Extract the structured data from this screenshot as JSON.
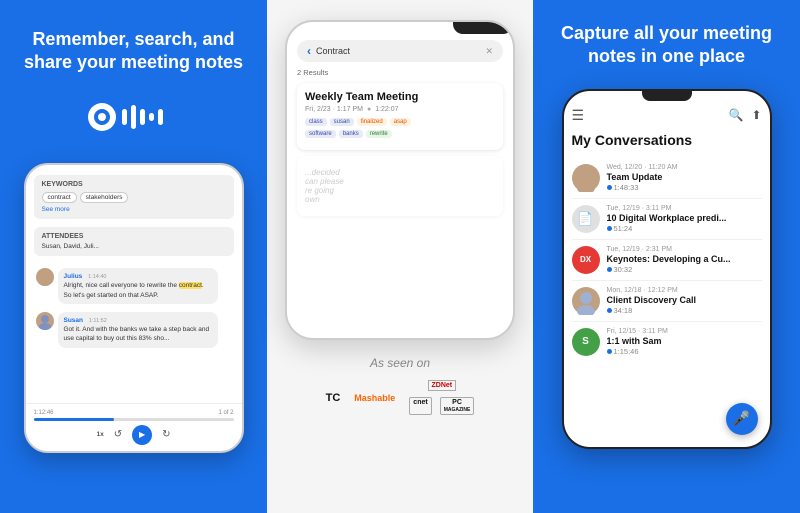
{
  "panels": {
    "left": {
      "headline": "Remember, search, and share your meeting notes",
      "logo_alt": "Otter.ai logo",
      "chat": {
        "messages": [
          {
            "speaker": "Julius",
            "time": "1:14:40",
            "text": "Alright, nice call everyone to rewrite the contract. So let's get started on that ASAP.",
            "highlight": "contract"
          },
          {
            "speaker": "Susan",
            "time": "1:11:52",
            "text": "Got it. And with the banks we take a step back and use capital to buy out this 83% sho..."
          }
        ],
        "keywords": [
          "contract",
          "stakeholders"
        ],
        "see_more": "See more",
        "attendees": "Susan, David, Juli...",
        "audio_time": "1:12:46",
        "page_indicator": "1 of 2"
      }
    },
    "middle": {
      "search_placeholder": "Contract",
      "results_label": "2 Results",
      "meeting": {
        "title": "Weekly Team Meeting",
        "date": "Fri, 2/23 · 1:17 PM",
        "duration": "1:22:07",
        "tags_row1": [
          "class",
          "susan",
          "finalized",
          "asap"
        ],
        "tags_row2": [
          "software",
          "banks",
          "rewrite"
        ]
      },
      "as_seen_on": "As seen on",
      "logos": [
        "TechCrunch",
        "Mashable",
        "ZDNet",
        "CNET",
        "PC Magazine"
      ]
    },
    "right": {
      "headline": "Capture all your meeting notes in one place",
      "section_title": "My Conversations",
      "conversations": [
        {
          "date": "Wed, 12/20 · 11:20 AM",
          "name": "Team Update",
          "duration": "1:48:33",
          "avatar_type": "person",
          "avatar_initials": ""
        },
        {
          "date": "Tue, 12/19 · 3:11 PM",
          "name": "10 Digital Workplace predi...",
          "duration": "51:24",
          "avatar_type": "gray",
          "avatar_initials": "📄"
        },
        {
          "date": "Tue, 12/19 · 2:31 PM",
          "name": "Keynotes: Developing a Cu...",
          "duration": "30:32",
          "avatar_type": "red",
          "avatar_initials": "DX"
        },
        {
          "date": "Mon, 12/18 · 12:12 PM",
          "name": "Client Discovery Call",
          "duration": "34:18",
          "avatar_type": "person",
          "avatar_initials": ""
        },
        {
          "date": "Fri, 12/15 · 3:11 PM",
          "name": "1:1 with Sam",
          "duration": "1:15:46",
          "avatar_type": "green",
          "avatar_initials": "S"
        }
      ]
    }
  }
}
